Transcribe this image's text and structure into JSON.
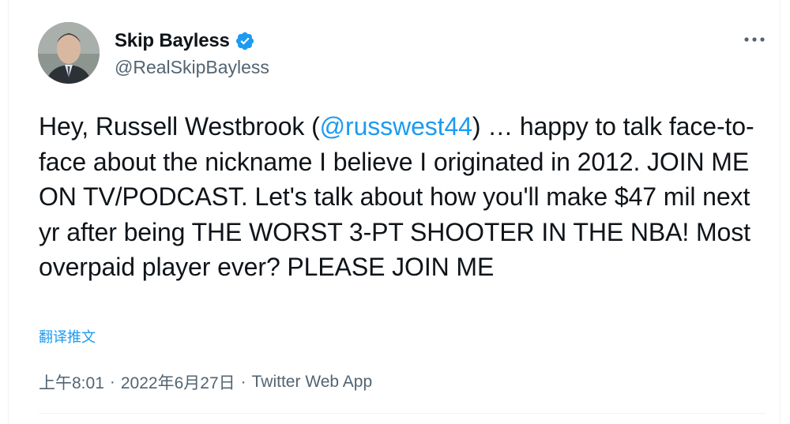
{
  "tweet": {
    "author": {
      "display_name": "Skip Bayless",
      "handle": "@RealSkipBayless",
      "verified": true
    },
    "text": {
      "before_mention": "Hey, Russell Westbrook (",
      "mention": "@russwest44",
      "after_mention": ") … happy to talk face-to-face about the nickname I believe I originated in 2012. JOIN ME ON TV/PODCAST. Let's talk about how you'll make $47 mil next yr after being THE WORST 3-PT SHOOTER IN THE NBA! Most overpaid player ever? PLEASE JOIN ME"
    },
    "translate_label": "翻译推文",
    "meta": {
      "time": "上午8:01",
      "separator": "·",
      "date": "2022年6月27日",
      "source": "Twitter Web App"
    }
  },
  "icons": {
    "verified": "verified-badge-icon",
    "more": "more-options-icon"
  },
  "colors": {
    "link": "#1d9bf0",
    "secondary_text": "#536471",
    "primary_text": "#0f1419",
    "divider": "#eff3f4"
  }
}
